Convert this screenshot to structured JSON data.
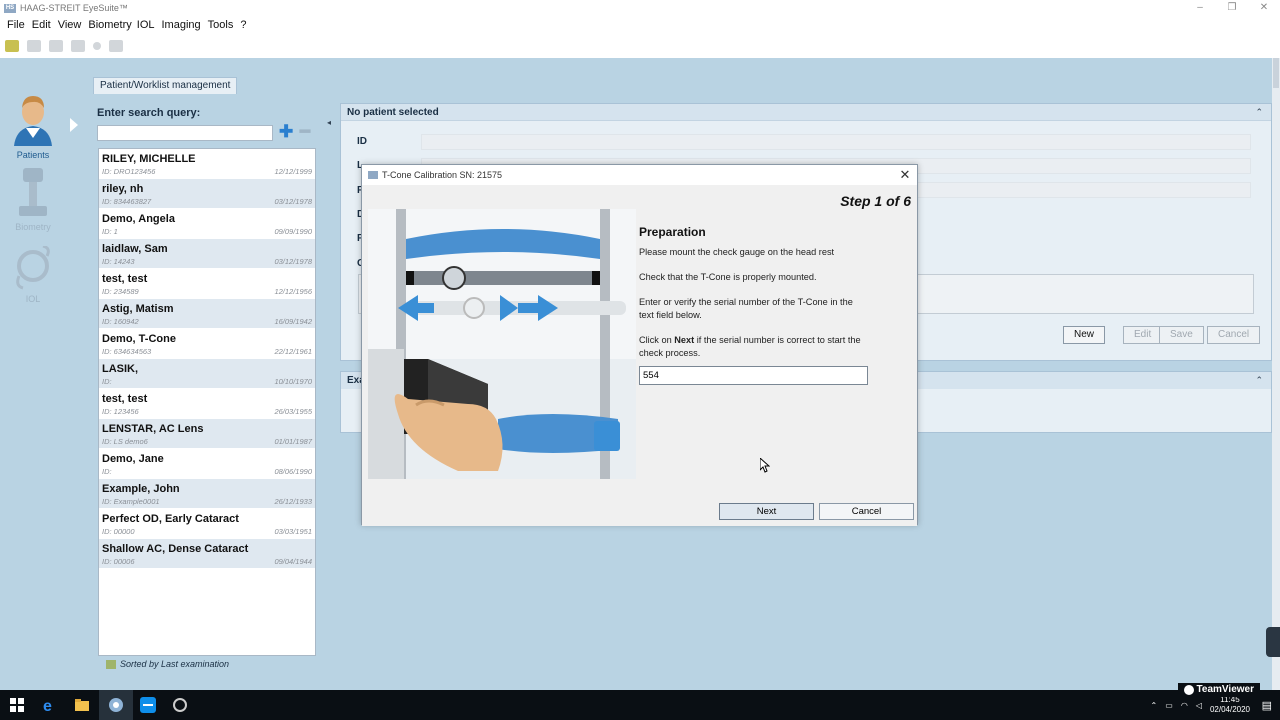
{
  "window": {
    "title": "HAAG-STREIT EyeSuite™",
    "logo_text": "HS"
  },
  "menu": [
    "File",
    "Edit",
    "View",
    "Biometry",
    "IOL",
    "Imaging",
    "Tools",
    "?"
  ],
  "nav": {
    "patients": "Patients",
    "biometry": "Biometry",
    "iol": "IOL"
  },
  "tab_label": "Patient/Worklist management",
  "search": {
    "label": "Enter search query:",
    "value": ""
  },
  "patients": [
    {
      "name": "RILEY, MICHELLE",
      "id": "ID: DRO123456",
      "dob": "12/12/1999"
    },
    {
      "name": "riley, nh",
      "id": "ID: 834463827",
      "dob": "03/12/1978"
    },
    {
      "name": "Demo, Angela",
      "id": "ID: 1",
      "dob": "09/09/1990"
    },
    {
      "name": "laidlaw, Sam",
      "id": "ID: 14243",
      "dob": "03/12/1978"
    },
    {
      "name": "test, test",
      "id": "ID: 234589",
      "dob": "12/12/1956"
    },
    {
      "name": "Astig, Matism",
      "id": "ID: 160942",
      "dob": "16/09/1942"
    },
    {
      "name": "Demo, T-Cone",
      "id": "ID: 634634563",
      "dob": "22/12/1961"
    },
    {
      "name": "LASIK,",
      "id": "ID:",
      "dob": "10/10/1970"
    },
    {
      "name": "test, test",
      "id": "ID: 123456",
      "dob": "26/03/1955"
    },
    {
      "name": "LENSTAR, AC Lens",
      "id": "ID: LS demo6",
      "dob": "01/01/1987"
    },
    {
      "name": "Demo, Jane",
      "id": "ID:",
      "dob": "08/06/1990"
    },
    {
      "name": "Example, John",
      "id": "ID: Example0001",
      "dob": "26/12/1933"
    },
    {
      "name": "Perfect OD, Early Cataract",
      "id": "ID: 00000",
      "dob": "03/03/1951"
    },
    {
      "name": "Shallow AC, Dense Cataract",
      "id": "ID: 00006",
      "dob": "09/04/1944"
    }
  ],
  "sort_label": "Sorted by Last examination",
  "details": {
    "header": "No patient selected",
    "fields": [
      "ID",
      "L",
      "F",
      "D",
      "F",
      "C"
    ],
    "buttons": {
      "new": "New",
      "edit": "Edit",
      "save": "Save",
      "cancel": "Cancel"
    }
  },
  "exam_header": "Exa",
  "dialog": {
    "title": "T-Cone Calibration SN: 21575",
    "step": "Step 1 of 6",
    "heading": "Preparation",
    "p1": "Please mount the check gauge on the head rest",
    "p2": "Check that the T-Cone is properly mounted.",
    "p3": "Enter or verify the serial number of the T-Cone in the text field below.",
    "p4_bold": "Next",
    "p4_pre": "Click on ",
    "p4_post": " if the serial number is correct to start the check process.",
    "serial_value": "554",
    "next": "Next",
    "cancel": "Cancel"
  },
  "taskbar": {
    "time": "11:45",
    "date": "02/04/2020",
    "teamviewer": "TeamViewer"
  }
}
